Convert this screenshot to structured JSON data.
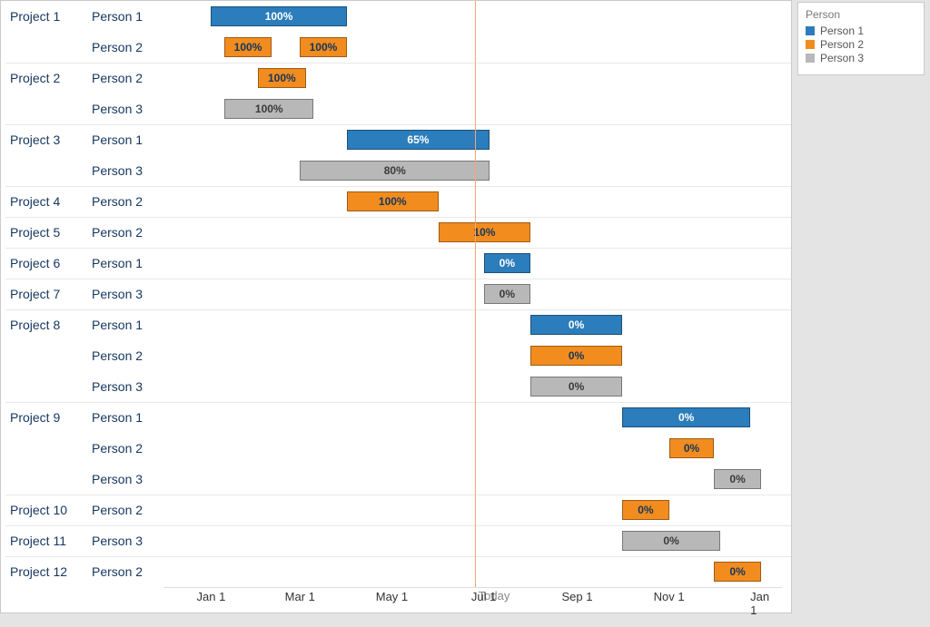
{
  "chart_data": {
    "type": "gantt",
    "x_start": "2018-12-01",
    "x_end": "2020-01-15",
    "today": "2019-06-25",
    "today_label": "Today",
    "x_ticks": [
      "Jan 1",
      "Mar 1",
      "May 1",
      "Jul 1",
      "Sep 1",
      "Nov 1",
      "Jan 1"
    ],
    "x_tick_dates": [
      "2019-01-01",
      "2019-03-01",
      "2019-05-01",
      "2019-07-01",
      "2019-09-01",
      "2019-11-01",
      "2020-01-01"
    ],
    "legend": {
      "title": "Person",
      "items": [
        "Person 1",
        "Person 2",
        "Person 3"
      ]
    },
    "colors": {
      "Person 1": "#2b7dbb",
      "Person 2": "#f28c1f",
      "Person 3": "#b8b8b8"
    },
    "projects": [
      {
        "name": "Project 1",
        "tasks": [
          {
            "person": "Person 1",
            "start": "2019-01-01",
            "end": "2019-04-01",
            "pct": "100%"
          },
          {
            "person": "Person 2",
            "segments": [
              {
                "start": "2019-01-10",
                "end": "2019-02-10",
                "pct": "100%"
              },
              {
                "start": "2019-03-01",
                "end": "2019-04-01",
                "pct": "100%"
              }
            ]
          }
        ]
      },
      {
        "name": "Project 2",
        "tasks": [
          {
            "person": "Person 2",
            "start": "2019-02-01",
            "end": "2019-03-05",
            "pct": "100%"
          },
          {
            "person": "Person 3",
            "start": "2019-01-10",
            "end": "2019-03-10",
            "pct": "100%"
          }
        ]
      },
      {
        "name": "Project 3",
        "tasks": [
          {
            "person": "Person 1",
            "start": "2019-04-01",
            "end": "2019-07-05",
            "pct": "65%"
          },
          {
            "person": "Person 3",
            "start": "2019-03-01",
            "end": "2019-07-05",
            "pct": "80%"
          }
        ]
      },
      {
        "name": "Project 4",
        "tasks": [
          {
            "person": "Person 2",
            "start": "2019-04-01",
            "end": "2019-06-01",
            "pct": "100%"
          }
        ]
      },
      {
        "name": "Project 5",
        "tasks": [
          {
            "person": "Person 2",
            "start": "2019-06-01",
            "end": "2019-08-01",
            "pct": "10%"
          }
        ]
      },
      {
        "name": "Project 6",
        "tasks": [
          {
            "person": "Person 1",
            "start": "2019-07-01",
            "end": "2019-08-01",
            "pct": "0%"
          }
        ]
      },
      {
        "name": "Project 7",
        "tasks": [
          {
            "person": "Person 3",
            "start": "2019-07-01",
            "end": "2019-08-01",
            "pct": "0%"
          }
        ]
      },
      {
        "name": "Project 8",
        "tasks": [
          {
            "person": "Person 1",
            "start": "2019-08-01",
            "end": "2019-10-01",
            "pct": "0%"
          },
          {
            "person": "Person 2",
            "start": "2019-08-01",
            "end": "2019-10-01",
            "pct": "0%"
          },
          {
            "person": "Person 3",
            "start": "2019-08-01",
            "end": "2019-10-01",
            "pct": "0%"
          }
        ]
      },
      {
        "name": "Project 9",
        "tasks": [
          {
            "person": "Person 1",
            "start": "2019-10-01",
            "end": "2019-12-25",
            "pct": "0%"
          },
          {
            "person": "Person 2",
            "start": "2019-11-01",
            "end": "2019-12-01",
            "pct": "0%"
          },
          {
            "person": "Person 3",
            "start": "2019-12-01",
            "end": "2020-01-01",
            "pct": "0%"
          }
        ]
      },
      {
        "name": "Project 10",
        "tasks": [
          {
            "person": "Person 2",
            "start": "2019-10-01",
            "end": "2019-11-01",
            "pct": "0%"
          }
        ]
      },
      {
        "name": "Project 11",
        "tasks": [
          {
            "person": "Person 3",
            "start": "2019-10-01",
            "end": "2019-12-05",
            "pct": "0%"
          }
        ]
      },
      {
        "name": "Project 12",
        "tasks": [
          {
            "person": "Person 2",
            "start": "2019-12-01",
            "end": "2020-01-01",
            "pct": "0%"
          }
        ]
      }
    ]
  }
}
